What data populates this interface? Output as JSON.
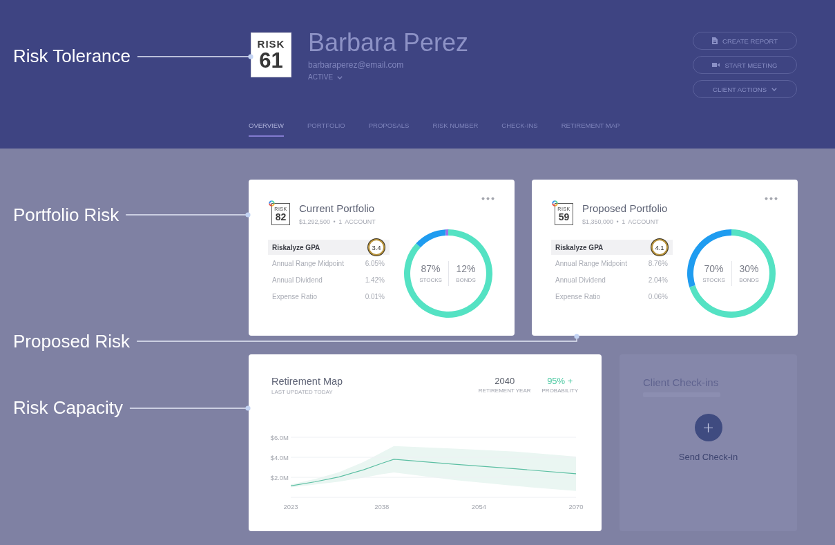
{
  "callouts": [
    {
      "label": "Risk Tolerance"
    },
    {
      "label": "Portfolio Risk"
    },
    {
      "label": "Proposed Risk"
    },
    {
      "label": "Risk Capacity"
    }
  ],
  "header": {
    "risk_badge": {
      "label": "RISK",
      "score": "61"
    },
    "client_name": "Barbara Perez",
    "email": "barbaraperez@email.com",
    "status": "ACTIVE",
    "actions": [
      {
        "kind": "report",
        "label": "CREATE REPORT"
      },
      {
        "kind": "meeting",
        "label": "START MEETING"
      },
      {
        "kind": "menu",
        "label": "CLIENT ACTIONS"
      }
    ],
    "tabs": [
      {
        "label": "OVERVIEW",
        "selected": true
      },
      {
        "label": "PORTFOLIO",
        "selected": false
      },
      {
        "label": "PROPOSALS",
        "selected": false
      },
      {
        "label": "RISK NUMBER",
        "selected": false
      },
      {
        "label": "CHECK-INS",
        "selected": false
      },
      {
        "label": "RETIREMENT MAP",
        "selected": false
      }
    ]
  },
  "portfolios": [
    {
      "title": "Current Portfolio",
      "risk_badge": {
        "label": "RISK",
        "score": "82"
      },
      "subtitle": "$1,292,500 • 1 ACCOUNT",
      "gpa": {
        "label": "Riskalyze GPA",
        "score": "3.4"
      },
      "metrics": [
        {
          "label": "Annual Range Midpoint",
          "value": "6.05%"
        },
        {
          "label": "Annual Dividend",
          "value": "1.42%"
        },
        {
          "label": "Expense Ratio",
          "value": "0.01%"
        }
      ],
      "allocation": [
        {
          "percent": "87%",
          "label": "STOCKS"
        },
        {
          "percent": "12%",
          "label": "BONDS"
        }
      ],
      "chart_data": {
        "type": "donut",
        "values": [
          87,
          12,
          1
        ]
      }
    },
    {
      "title": "Proposed Portfolio",
      "risk_badge": {
        "label": "RISK",
        "score": "59"
      },
      "subtitle": "$1,350,000 • 1 ACCOUNT",
      "gpa": {
        "label": "Riskalyze GPA",
        "score": "4.1"
      },
      "metrics": [
        {
          "label": "Annual Range Midpoint",
          "value": "8.76%"
        },
        {
          "label": "Annual Dividend",
          "value": "2.04%"
        },
        {
          "label": "Expense Ratio",
          "value": "0.06%"
        }
      ],
      "allocation": [
        {
          "percent": "70%",
          "label": "STOCKS"
        },
        {
          "percent": "30%",
          "label": "BONDS"
        }
      ],
      "chart_data": {
        "type": "donut",
        "values": [
          70,
          30
        ]
      }
    }
  ],
  "retirement_map": {
    "title": "Retirement Map",
    "updated": "LAST UPDATED TODAY",
    "stats": [
      {
        "value": "2040",
        "label": "RETIREMENT YEAR",
        "color": "#555a66"
      },
      {
        "value": "95% +",
        "label": "PROBABILITY",
        "color": "#4cc9a2"
      }
    ],
    "chart_data": {
      "type": "line",
      "x": [
        2023,
        2027,
        2031,
        2035,
        2038,
        2040,
        2050,
        2060,
        2070
      ],
      "series": [
        {
          "values": [
            1.15,
            1.55,
            2.05,
            2.75,
            3.4,
            3.8,
            3.3,
            2.85,
            2.35
          ]
        }
      ],
      "xticks": [
        2023,
        2038,
        2054,
        2070
      ],
      "yticks": [
        {
          "value": 2,
          "label": "$2.0M"
        },
        {
          "value": 4,
          "label": "$4.0M"
        },
        {
          "value": 6,
          "label": "$6.0M"
        }
      ],
      "xlim": [
        2023,
        2070
      ],
      "ylim": [
        0,
        6
      ]
    }
  },
  "check_ins": {
    "title": "Client Check-ins",
    "action": "Send Check-in"
  }
}
